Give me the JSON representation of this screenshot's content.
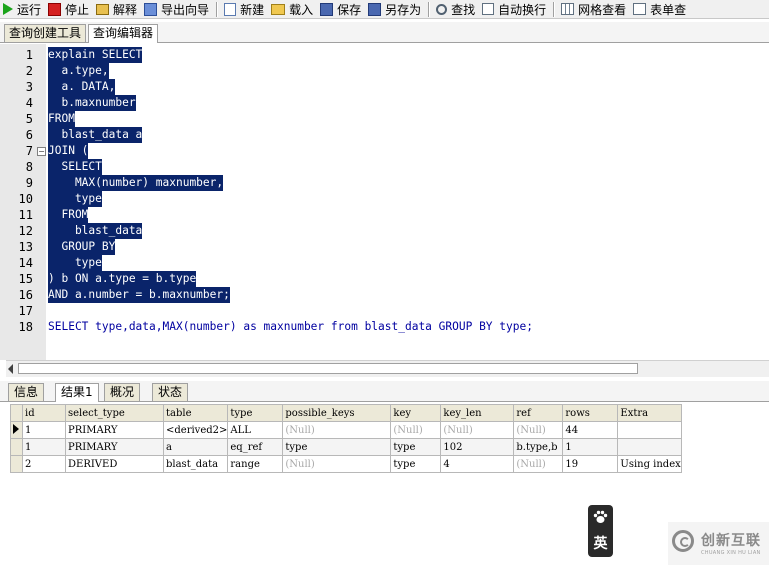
{
  "toolbar": {
    "items": [
      {
        "label": "运行",
        "icon": "run-icon"
      },
      {
        "label": "停止",
        "icon": "stop-icon"
      },
      {
        "label": "解释",
        "icon": "explain-icon"
      },
      {
        "label": "导出向导",
        "icon": "export-wizard-icon"
      },
      {
        "label": "新建",
        "icon": "new-icon"
      },
      {
        "label": "载入",
        "icon": "open-folder-icon"
      },
      {
        "label": "保存",
        "icon": "save-icon"
      },
      {
        "label": "另存为",
        "icon": "save-as-icon"
      },
      {
        "label": "查找",
        "icon": "find-icon"
      },
      {
        "label": "自动换行",
        "icon": "word-wrap-icon"
      },
      {
        "label": "网格查看",
        "icon": "grid-view-icon"
      },
      {
        "label": "表单查",
        "icon": "form-view-icon"
      }
    ]
  },
  "top_tabs": [
    {
      "label": "查询创建工具",
      "active": false
    },
    {
      "label": "查询编辑器",
      "active": true
    }
  ],
  "editor": {
    "lines": [
      {
        "num": "1",
        "text": "explain SELECT",
        "selected": true
      },
      {
        "num": "2",
        "text": "  a.type,",
        "selected": true
      },
      {
        "num": "3",
        "text": "  a. DATA,",
        "selected": true
      },
      {
        "num": "4",
        "text": "  b.maxnumber",
        "selected": true
      },
      {
        "num": "5",
        "text": "FROM",
        "selected": true
      },
      {
        "num": "6",
        "text": "  blast_data a",
        "selected": true
      },
      {
        "num": "7",
        "text": "JOIN (",
        "selected": true
      },
      {
        "num": "8",
        "text": "  SELECT",
        "selected": true
      },
      {
        "num": "9",
        "text": "    MAX(number) maxnumber,",
        "selected": true
      },
      {
        "num": "10",
        "text": "    type",
        "selected": true
      },
      {
        "num": "11",
        "text": "  FROM",
        "selected": true
      },
      {
        "num": "12",
        "text": "    blast_data",
        "selected": true
      },
      {
        "num": "13",
        "text": "  GROUP BY",
        "selected": true
      },
      {
        "num": "14",
        "text": "    type",
        "selected": true
      },
      {
        "num": "15",
        "text": ") b ON a.type = b.type",
        "selected": true
      },
      {
        "num": "16",
        "text": "AND a.number = b.maxnumber;",
        "selected": true
      },
      {
        "num": "17",
        "text": "",
        "selected": false
      },
      {
        "num": "18",
        "text": "SELECT type,data,MAX(number) as maxnumber from blast_data GROUP BY type;",
        "selected": false
      }
    ]
  },
  "bottom_tabs": [
    {
      "label": "信息",
      "active": false
    },
    {
      "label": "结果1",
      "active": true
    },
    {
      "label": "概况",
      "active": false
    },
    {
      "label": "状态",
      "active": false
    }
  ],
  "results": {
    "columns": [
      "id",
      "select_type",
      "table",
      "type",
      "possible_keys",
      "key",
      "key_len",
      "ref",
      "rows",
      "Extra"
    ],
    "rows": [
      [
        "1",
        "PRIMARY",
        "<derived2>",
        "ALL",
        "(Null)",
        "(Null)",
        "(Null)",
        "(Null)",
        "44",
        ""
      ],
      [
        "1",
        "PRIMARY",
        "a",
        "eq_ref",
        "type",
        "type",
        "102",
        "b.type,b",
        "1",
        ""
      ],
      [
        "2",
        "DERIVED",
        "blast_data",
        "range",
        "(Null)",
        "type",
        "4",
        "(Null)",
        "19",
        "Using index"
      ]
    ],
    "current_row": 0
  },
  "ime": {
    "lang": "英",
    "icon": "paw-icon"
  },
  "watermark": {
    "text": "创新互联",
    "sub": "CHUANG XIN HU LIAN"
  }
}
